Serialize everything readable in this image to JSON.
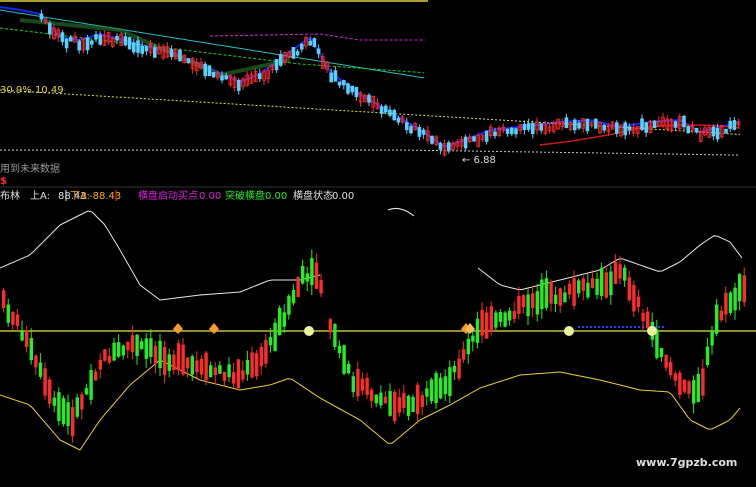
{
  "colors": {
    "background": "#000000",
    "up": "#ff2a2a",
    "down": "#22ee22",
    "boll_upper": "#e8e8e8",
    "boll_lower": "#e6d23a",
    "midline": "#e6e64a",
    "ma_blue": "#1a22ff",
    "ma_cyan": "#20c0c0",
    "ma_magenta": "#e020e0",
    "ma_green": "#22cc22",
    "ma_yellow": "#e6e64a",
    "ma_red": "#cc1a1a",
    "label_white": "#e0e0e0",
    "label_magenta": "#e020e0",
    "label_green": "#22ee22",
    "label_red": "#ff2a2a",
    "label_orange": "#ffaa00",
    "label_grey": "#bbbbbb"
  },
  "upper_panel": {
    "pct_label": "30.9% 10.49",
    "low_label": "← 6.88",
    "future_label": "用到未来数据",
    "currency_icon": "$"
  },
  "indicator_header": {
    "name": "布林",
    "upper": {
      "label": "上A:",
      "value": "88.43"
    },
    "lower": {
      "label": "下A:",
      "value": "-88.43"
    },
    "sig1": {
      "label": "横盘启动买点",
      "value": "0.00"
    },
    "sig2": {
      "label": "突破横盘",
      "value": "0.00"
    },
    "sig3": {
      "label": "横盘状态",
      "value": "0.00"
    }
  },
  "watermark": "www.7gpzb.com",
  "chart_data": [
    {
      "type": "candlestick",
      "title": "",
      "annotations": [
        "30.9% 10.49",
        "← 6.88",
        "用到未来数据"
      ],
      "price_high_pct_label": 10.49,
      "price_low_label": 6.88,
      "legend": [],
      "grid": false
    },
    {
      "type": "bar",
      "title": "布林",
      "series": [
        {
          "name": "上A",
          "value": 88.43
        },
        {
          "name": "下A",
          "value": -88.43
        },
        {
          "name": "横盘启动买点",
          "value": 0.0
        },
        {
          "name": "突破横盘",
          "value": 0.0
        },
        {
          "name": "横盘状态",
          "value": 0.0
        }
      ],
      "ylim": [
        -88.43,
        88.43
      ],
      "grid": false
    }
  ]
}
